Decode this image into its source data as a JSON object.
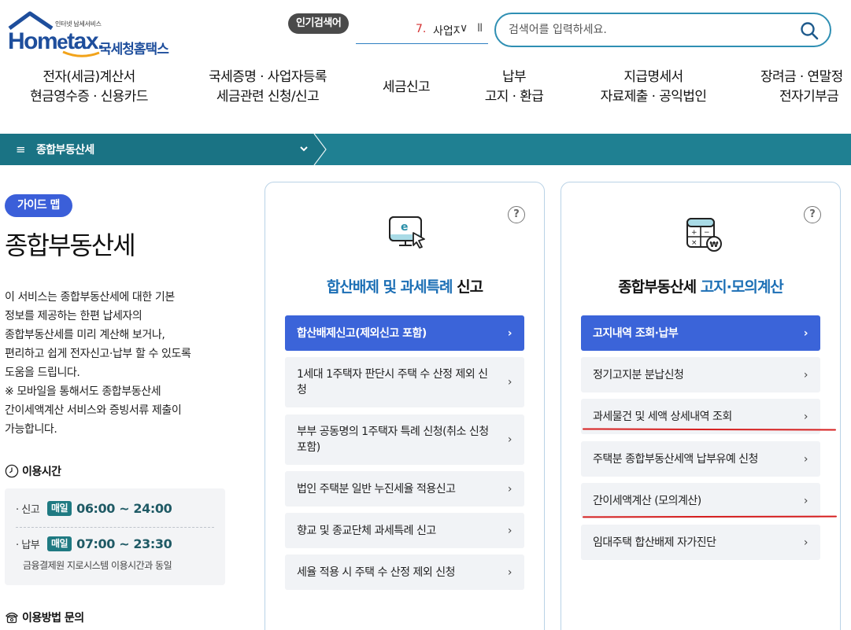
{
  "header": {
    "logo_tagline": "인터넷 납세서비스",
    "logo_word_pre": "Hom",
    "logo_word_e": "e",
    "logo_word_post": "tax.",
    "logo_korean": "국세청홈택스",
    "popular_label": "인기검색어",
    "popular_rank": "7.",
    "popular_keyword": "사업자",
    "search_placeholder": "검색어를 입력하세요."
  },
  "gnb": [
    {
      "line1": "전자(세금)계산서",
      "line2": "현금영수증 · 신용카드"
    },
    {
      "line1": "국세증명 · 사업자등록",
      "line2": "세금관련 신청/신고"
    },
    {
      "line1": "세금신고",
      "line2": ""
    },
    {
      "line1": "납부",
      "line2": "고지 · 환급"
    },
    {
      "line1": "지급명세서",
      "line2": "자료제출 · 공익법인"
    },
    {
      "line1": "장려금 · 연말정",
      "line2": "전자기부금"
    }
  ],
  "tealbar": {
    "title": "종합부동산세"
  },
  "left": {
    "guide_label": "가이드 맵",
    "page_title": "종합부동산세",
    "desc": [
      "이 서비스는 종합부동산세에 대한 기본",
      "정보를 제공하는 한편 납세자의",
      "종합부동산세를 미리 계산해 보거나,",
      "편리하고 쉽게 전자신고·납부 할 수 있도록",
      "도움을 드립니다.",
      "※ 모바일을 통해서도 종합부동산세",
      "간이세액계산 서비스와 증빙서류 제출이",
      "가능합니다."
    ],
    "hours_title": "이용시간",
    "hours": [
      {
        "label": "신고",
        "badge": "매일",
        "time": "06:00 ~ 24:00"
      },
      {
        "label": "납부",
        "badge": "매일",
        "time": "07:00 ~ 23:30"
      }
    ],
    "hours_note": "금융결제원 지로시스템 이용시간과 동일",
    "inquiry_title": "이용방법 문의"
  },
  "cards": [
    {
      "title_hl": "합산배제 및 과세특례",
      "title_rest": " 신고",
      "items": [
        "합산배제신고(제외신고 포함)",
        "1세대 1주택자 판단시 주택 수 산정 제외 신청",
        "부부 공동명의 1주택자 특례 신청(취소 신청 포함)",
        "법인 주택분 일반 누진세율 적용신고",
        "향교 및 종교단체 과세특례 신고",
        "세율 적용 시 주택 수 산정 제외 신청"
      ]
    },
    {
      "title_pre": "종합부동산세 ",
      "title_hl": "고지·모의계산",
      "items": [
        "고지내역 조회·납부",
        "정기고지분 분납신청",
        "과세물건 및 세액 상세내역 조회",
        "주택분 종합부동산세액 납부유예 신청",
        "간이세액계산 (모의계산)",
        "임대주택 합산배제 자가진단"
      ]
    }
  ],
  "colors": {
    "teal": "#1f8092",
    "primary_btn": "#3b64d9",
    "annotation": "#d61f1f"
  }
}
